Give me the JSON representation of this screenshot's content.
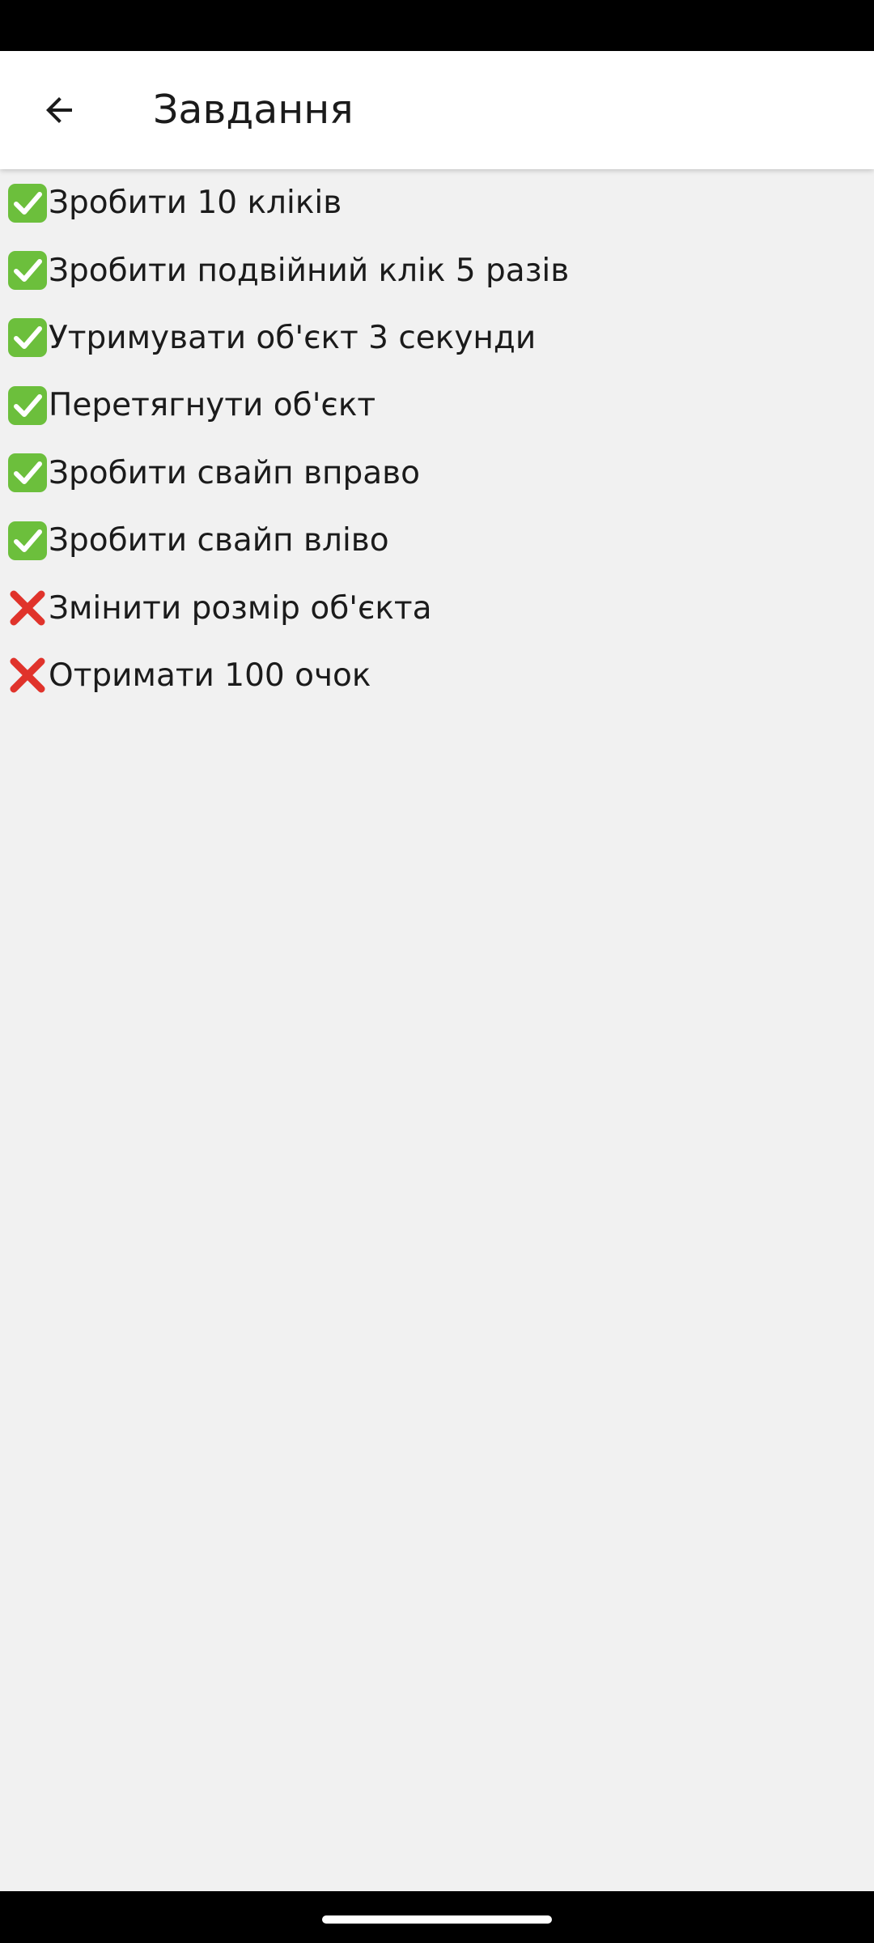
{
  "app_bar": {
    "title": "Завдання",
    "back_icon": "arrow-back-icon"
  },
  "colors": {
    "done": "#6cbf3c",
    "not_done": "#e0332b",
    "background": "#f1f1f1",
    "app_bar": "#ffffff"
  },
  "tasks": [
    {
      "label": "Зробити 10 кліків",
      "status": "done",
      "icon": "check-mark-icon"
    },
    {
      "label": "Зробити подвійний клік 5 разів",
      "status": "done",
      "icon": "check-mark-icon"
    },
    {
      "label": "Утримувати об'єкт 3 секунди",
      "status": "done",
      "icon": "check-mark-icon"
    },
    {
      "label": "Перетягнути об'єкт",
      "status": "done",
      "icon": "check-mark-icon"
    },
    {
      "label": "Зробити свайп вправо",
      "status": "done",
      "icon": "check-mark-icon"
    },
    {
      "label": "Зробити свайп вліво",
      "status": "done",
      "icon": "check-mark-icon"
    },
    {
      "label": "Змінити розмір об'єкта",
      "status": "not_done",
      "icon": "cross-mark-icon"
    },
    {
      "label": "Отримати 100 очок",
      "status": "not_done",
      "icon": "cross-mark-icon"
    }
  ]
}
